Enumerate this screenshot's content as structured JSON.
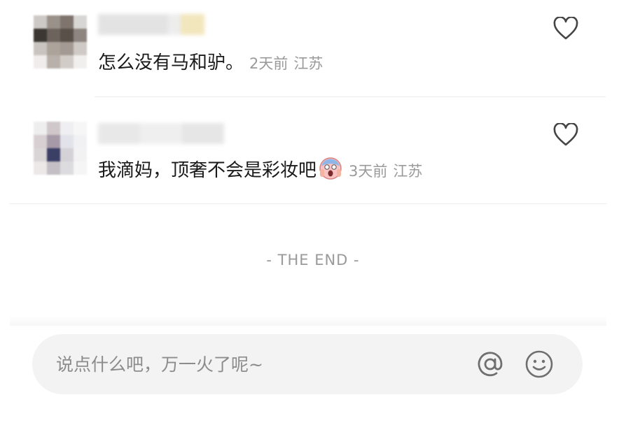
{
  "comments": [
    {
      "text": "怎么没有马和驴。",
      "time": "2天前",
      "location": "江苏",
      "like_icon": "heart-outline-icon",
      "avatar_colors": [
        "#cdc9c6",
        "#9b918b",
        "#7f746e",
        "#d8d6d4",
        "#3c3733",
        "#6d635d",
        "#585049",
        "#8e8580",
        "#c9c4bf",
        "#aca39b",
        "#a39a93",
        "#cfcac6",
        "#efeceb",
        "#b8b0aa",
        "#d2ccc8",
        "#f1efee"
      ]
    },
    {
      "text": "我滴妈，顶奢不会是彩妆吧",
      "emoji": "face-screaming-in-fear",
      "time": "3天前",
      "location": "江苏",
      "like_icon": "heart-outline-icon",
      "avatar_colors": [
        "#eeeeee",
        "#cfc7c9",
        "#efeff1",
        "#f6f6f7",
        "#d7cfd2",
        "#a69aa8",
        "#e2e3ea",
        "#f1f1f3",
        "#d9d5d6",
        "#3b3f66",
        "#d4d2d7",
        "#f2f2f2",
        "#ece8e8",
        "#c3bfc4",
        "#dcdbde",
        "#f5f5f5"
      ]
    }
  ],
  "end_text": "- THE END -",
  "input_bar": {
    "placeholder": "说点什么吧，万一火了呢~",
    "mention_icon": "at-icon",
    "emoji_icon": "smiley-icon"
  },
  "colors": {
    "text": "#1a1a1a",
    "meta": "#9a9a9a",
    "input_bg": "#f3f3f3",
    "divider": "#ececec"
  }
}
